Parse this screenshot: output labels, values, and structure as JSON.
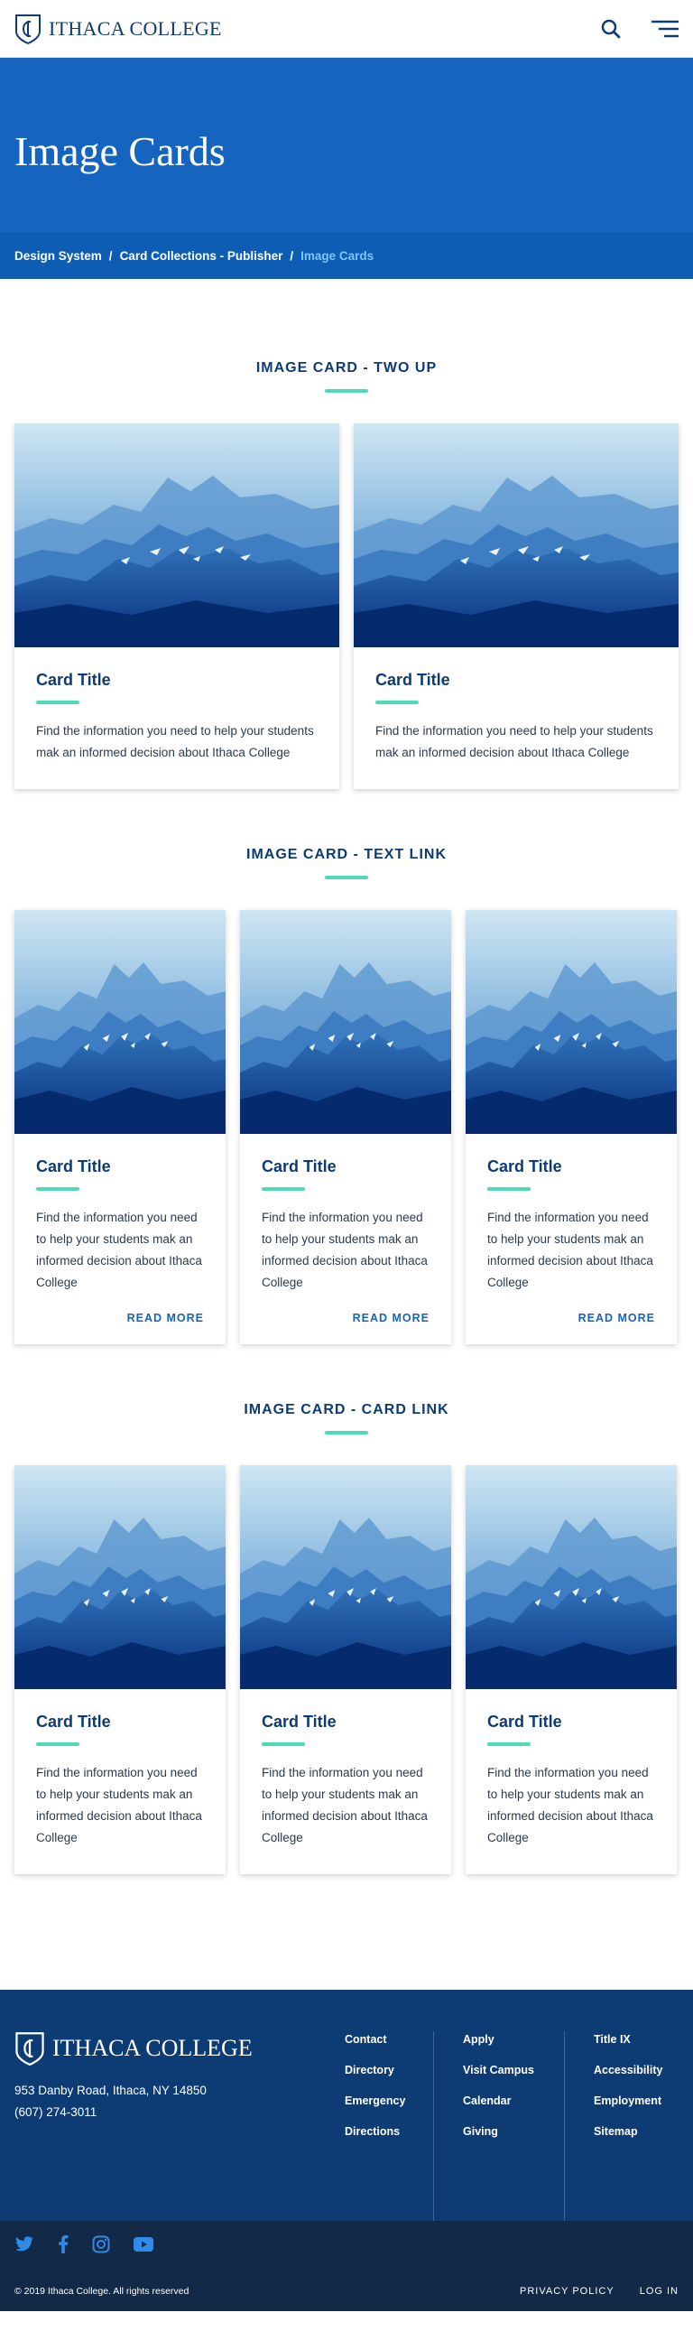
{
  "header": {
    "brand": "ITHACA COLLEGE",
    "search_icon": "search-icon",
    "menu_icon": "hamburger-menu-icon"
  },
  "hero": {
    "title": "Image Cards"
  },
  "breadcrumb": {
    "items": [
      "Design System",
      "Card Collections - Publisher"
    ],
    "separator": "/",
    "current": "Image Cards"
  },
  "sections": [
    {
      "title": "IMAGE CARD - TWO UP",
      "cards": [
        {
          "title": "Card Title",
          "text": "Find the information you need to help your students mak an informed decision about Ithaca College"
        },
        {
          "title": "Card Title",
          "text": "Find the information you need to help your students mak an informed decision about Ithaca College"
        }
      ]
    },
    {
      "title": "IMAGE CARD - TEXT LINK",
      "cards": [
        {
          "title": "Card Title",
          "text": "Find the information you need to help your students mak an informed decision about Ithaca College",
          "link": "READ MORE"
        },
        {
          "title": "Card Title",
          "text": "Find the information you need to help your students mak an informed decision about Ithaca College",
          "link": "READ MORE"
        },
        {
          "title": "Card Title",
          "text": "Find the information you need to help your students mak an informed decision about Ithaca College",
          "link": "READ MORE"
        }
      ]
    },
    {
      "title": "IMAGE CARD - CARD LINK",
      "cards": [
        {
          "title": "Card Title",
          "text": "Find the information you need to help your students mak an informed decision about Ithaca College"
        },
        {
          "title": "Card Title",
          "text": "Find the information you need to help your students mak an informed decision about Ithaca College"
        },
        {
          "title": "Card Title",
          "text": "Find the information you need to help your students mak an informed decision about Ithaca College"
        }
      ]
    }
  ],
  "footer": {
    "brand": "ITHACA COLLEGE",
    "address": "953 Danby Road, Ithaca, NY 14850",
    "phone": "(607) 274-3011",
    "col1": [
      "Contact",
      "Directory",
      "Emergency",
      "Directions"
    ],
    "col2": [
      "Apply",
      "Visit Campus",
      "Calendar",
      "Giving"
    ],
    "col3": [
      "Title IX",
      "Accessibility",
      "Employment",
      "Sitemap"
    ],
    "social": [
      "twitter-icon",
      "facebook-icon",
      "instagram-icon",
      "youtube-icon"
    ],
    "copyright": "© 2019 Ithaca College. All rights reserved",
    "privacy": "PRIVACY POLICY",
    "login": "LOG IN"
  },
  "colors": {
    "brand_navy": "#0d3b74",
    "hero_blue": "#1565c0",
    "accent_mint": "#4fd9b6",
    "link_blue": "#1565c0"
  }
}
